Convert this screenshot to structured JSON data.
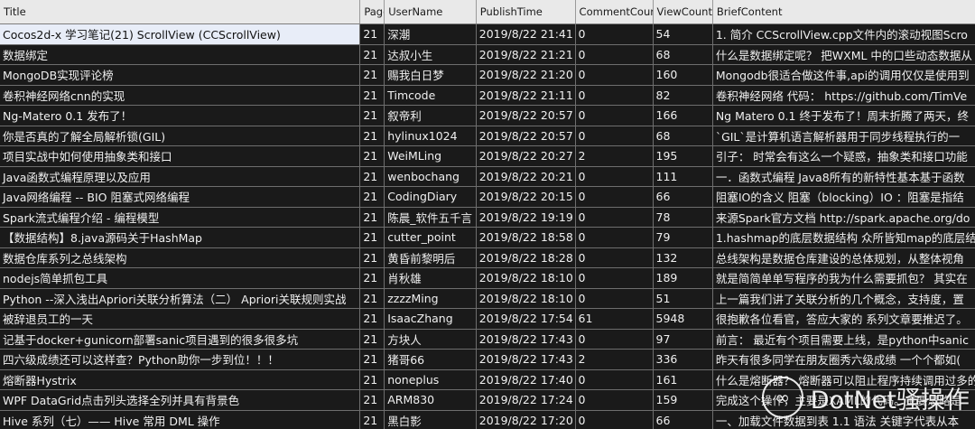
{
  "table": {
    "columns": [
      "Title",
      "Page",
      "UserName",
      "PublishTime",
      "CommentCount",
      "ViewCount",
      "BriefContent"
    ],
    "selected_row": 0,
    "rows": [
      [
        "Cocos2d-x 学习笔记(21) ScrollView (CCScrollView)",
        "21",
        "深潮",
        "2019/8/22 21:41",
        "0",
        "54",
        "1. 简介 CCScrollView.cpp文件内的滚动视图Scro"
      ],
      [
        "数据绑定",
        "21",
        "达叔小生",
        "2019/8/22 21:21",
        "0",
        "68",
        "什么是数据绑定呢？ 把WXML 中的口些动态数据从"
      ],
      [
        "MongoDB实现评论榜",
        "21",
        "赐我白日梦",
        "2019/8/22 21:20",
        "0",
        "160",
        "Mongodb很适合做这件事,api的调用仅仅是使用到"
      ],
      [
        "卷积神经网络cnn的实现",
        "21",
        "Timcode",
        "2019/8/22 21:11",
        "0",
        "82",
        "卷积神经网络 代码： https://github.com/TimVe"
      ],
      [
        "Ng-Matero 0.1 发布了！",
        "21",
        "叙帝利",
        "2019/8/22 20:57",
        "0",
        "166",
        "Ng Matero 0.1 终于发布了！周末折腾了两天，终"
      ],
      [
        "你是否真的了解全局解析锁(GIL)",
        "21",
        "hylinux1024",
        "2019/8/22 20:57",
        "0",
        "68",
        "`GIL`是计算机语言解析器用于同步线程执行的一"
      ],
      [
        "项目实战中如何使用抽象类和接口",
        "21",
        "WeiMLing",
        "2019/8/22 20:27",
        "2",
        "195",
        "引子： 时常会有这么一个疑惑，抽象类和接口功能"
      ],
      [
        "Java函数式编程原理以及应用",
        "21",
        "wenbochang",
        "2019/8/22 20:21",
        "0",
        "111",
        "一．函数式编程 Java8所有的新特性基本基于函数"
      ],
      [
        "Java网络编程 -- BIO 阻塞式网络编程",
        "21",
        "CodingDiary",
        "2019/8/22 20:15",
        "0",
        "66",
        "阻塞IO的含义 阻塞（blocking）IO ：阻塞是指结"
      ],
      [
        "Spark流式编程介绍 - 编程模型",
        "21",
        "陈晨_软件五千言",
        "2019/8/22 19:19",
        "0",
        "78",
        "来源Spark官方文档 http://spark.apache.org/do"
      ],
      [
        "【数据结构】8.java源码关于HashMap",
        "21",
        "cutter_point",
        "2019/8/22 18:58",
        "0",
        "79",
        "1.hashmap的底层数据结构 众所皆知map的底层结"
      ],
      [
        "数据仓库系列之总线架构",
        "21",
        "黄昏前黎明后",
        "2019/8/22 18:28",
        "0",
        "132",
        "总线架构是数据仓库建设的总体规划，从整体视角"
      ],
      [
        "nodejs简单抓包工具",
        "21",
        "肖秋雄",
        "2019/8/22 18:10",
        "0",
        "189",
        "就是简简单单写程序的我为什么需要抓包？ 其实在"
      ],
      [
        "Python --深入浅出Apriori关联分析算法（二） Apriori关联规则实战",
        "21",
        "zzzzMing",
        "2019/8/22 18:10",
        "0",
        "51",
        "上一篇我们讲了关联分析的几个概念，支持度，置"
      ],
      [
        "被辞退员工的一天",
        "21",
        "IsaacZhang",
        "2019/8/22 17:54",
        "61",
        "5948",
        "很抱歉各位看官，答应大家的 系列文章要推迟了。"
      ],
      [
        "记基于docker+gunicorn部署sanic项目遇到的很多很多坑",
        "21",
        "方块人",
        "2019/8/22 17:43",
        "0",
        "97",
        "前言： 最近有个项目需要上线，是python中sanic"
      ],
      [
        "四六级成绩还可以这样查？Python助你一步到位！！！",
        "21",
        "猪哥66",
        "2019/8/22 17:43",
        "2",
        "336",
        "昨天有很多同学在朋友圈秀六级成绩 一个个都如("
      ],
      [
        "熔断器Hystrix",
        "21",
        "noneplus",
        "2019/8/22 17:40",
        "0",
        "161",
        "什么是熔断器？ 熔断器可以阻止程序持续调用过多的"
      ],
      [
        "WPF DataGrid点击列头选择全列并具有背景色",
        "21",
        "ARM830",
        "2019/8/22 17:24",
        "0",
        "159",
        "完成这个操作，主要是XAML的代码。主要思路是"
      ],
      [
        "Hive 系列（七）—— Hive 常用 DML 操作",
        "21",
        "黑白影",
        "2019/8/22 17:20",
        "0",
        "66",
        "一、加载文件数据到表 1.1 语法 关键字代表从本"
      ]
    ]
  },
  "watermark": {
    "text": "DotNet骚操作",
    "logo_glyph": "∞",
    "logo_icon": "wechat-logo-icon"
  }
}
